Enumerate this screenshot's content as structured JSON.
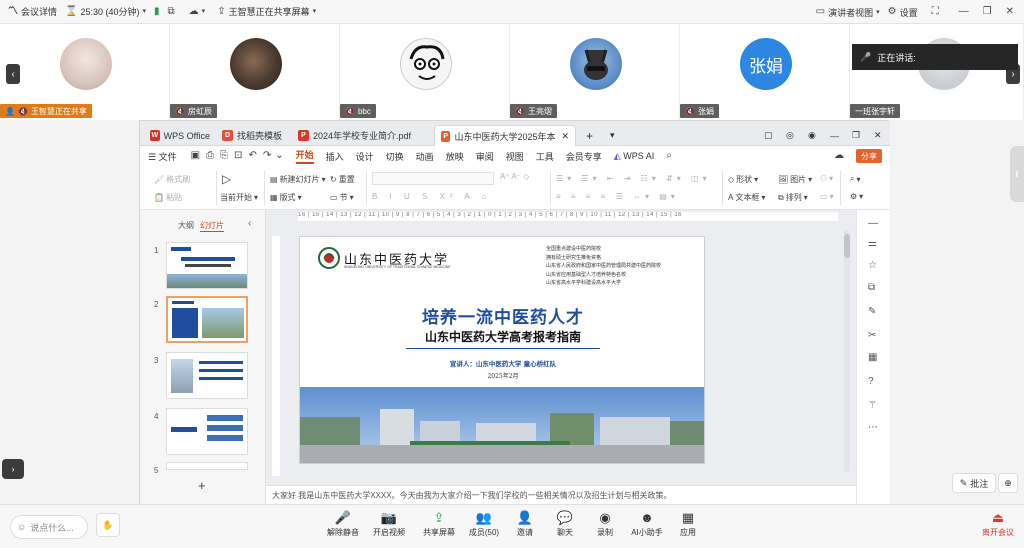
{
  "topbar": {
    "meeting_info": "会议详情",
    "timer": "25:30 (40分钟)",
    "sharing_status": "王智慧正在共享屏幕",
    "presenter_view": "演讲者视图",
    "settings": "设置"
  },
  "participants": [
    {
      "name": "王智慧正在共享",
      "avatar_text": ""
    },
    {
      "name": "房虹辰",
      "avatar_text": ""
    },
    {
      "name": "bbc",
      "avatar_text": ""
    },
    {
      "name": "王亮熠",
      "avatar_text": ""
    },
    {
      "name": "张娟",
      "avatar_text": "张娟"
    },
    {
      "name": "一班张宇轩",
      "avatar_text": ""
    }
  ],
  "speaking": {
    "label": "正在讲话:"
  },
  "app": {
    "tabs": [
      {
        "label": "WPS Office"
      },
      {
        "label": "找稻壳模板"
      },
      {
        "label": "2024年学校专业简介.pdf"
      },
      {
        "label": "山东中医药大学2025年本科..."
      }
    ],
    "menus": [
      "文件",
      "开始",
      "插入",
      "设计",
      "切换",
      "动画",
      "放映",
      "审阅",
      "视图",
      "工具",
      "会员专享",
      "WPS AI"
    ],
    "active_menu": "开始",
    "share_btn": "分享",
    "ribbon": {
      "format_painter": "格式刷",
      "paste": "粘贴",
      "start_from_current": "当前开始",
      "new_slide": "新建幻灯片",
      "layout": "版式",
      "reset": "重置",
      "section": "节",
      "shape": "形状",
      "picture": "图片",
      "textbox": "文本框",
      "arrange": "排列"
    },
    "outline_tab": "大纲",
    "slides_tab": "幻灯片",
    "slide_numbers": [
      "1",
      "2",
      "3",
      "4",
      "5"
    ],
    "ruler_text": "16 | 15 | 14 | 13 | 12 | 11 | 10 | 9 | 8 | 7 | 6 | 5 | 4 | 3 | 2 | 1 | 0 | 1 | 2 | 3 | 4 | 5 | 6 | 7 | 8 | 9 | 10 | 11 | 12 | 13 | 14 | 15 | 16",
    "notes": "大家好 我是山东中医药大学XXXX。今天由我为大家介绍一下我们学校的一些相关情况以及招生计划与相关政策。"
  },
  "slide": {
    "logo_cn": "山东中医药大学",
    "logo_en": "SHANDONG UNIVERSITY OF TRADITIONAL CHINESE MEDICINE",
    "honors": [
      "全国重点建设中医药院校",
      "拥有硕士研究生推免资格",
      "山东省人民政府和国家中医药管理局共建中医药院校",
      "山东省应用基础型人才培养特色名校",
      "山东省高水平学科建设高水平大学"
    ],
    "title": "培养一流中医药人才",
    "subtitle": "山东中医药大学高考报考指南",
    "speaker": "宣讲人：山东中医药大学  童心桥红队",
    "date": "2025年2月"
  },
  "side": {
    "annotate": "批注"
  },
  "bottom": {
    "chat_placeholder": "说点什么...",
    "buttons": [
      "解除静音",
      "开启视频",
      "共享屏幕",
      "成员(50)",
      "邀请",
      "聊天",
      "录制",
      "AI小助手",
      "应用"
    ],
    "leave": "离开会议"
  },
  "colors": {
    "accent": "#d04b1c",
    "slide_blue": "#1f4e9e",
    "leave_red": "#d9372b"
  }
}
